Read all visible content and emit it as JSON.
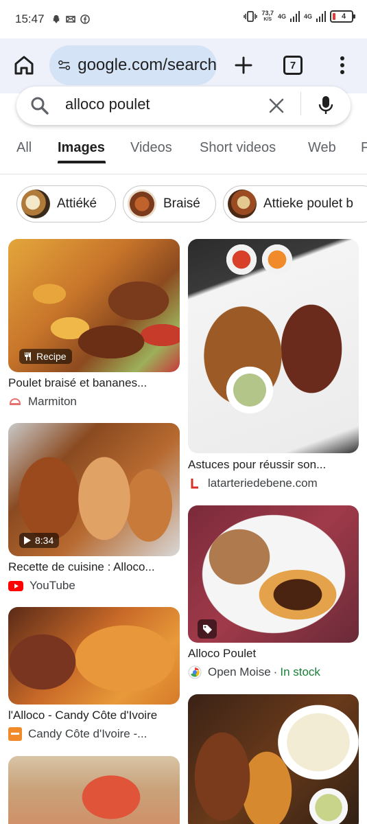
{
  "status_bar": {
    "time": "15:47",
    "net_speed": "73,7",
    "net_unit": "K/S",
    "signal1": "4G",
    "signal2": "4G",
    "battery": "4"
  },
  "browser": {
    "url": "google.com/search",
    "tab_count": "7"
  },
  "search": {
    "query": "alloco poulet"
  },
  "tabs": [
    {
      "label": "All"
    },
    {
      "label": "Images"
    },
    {
      "label": "Videos"
    },
    {
      "label": "Short videos"
    },
    {
      "label": "Web"
    },
    {
      "label": "F"
    }
  ],
  "chips": [
    {
      "label": "Attiéké"
    },
    {
      "label": "Braisé"
    },
    {
      "label": "Attieke poulet b"
    }
  ],
  "results": [
    {
      "title": "Poulet braisé et bananes...",
      "source": "Marmiton",
      "badge": "Recipe"
    },
    {
      "title": "Astuces pour réussir son...",
      "source": "latarteriedebene.com"
    },
    {
      "title": "Recette de cuisine : Alloco...",
      "source": "YouTube",
      "badge": "8:34"
    },
    {
      "title": "Alloco Poulet",
      "source": "Open Moise",
      "separator": "·",
      "stock": "In stock"
    },
    {
      "title": "l'Alloco - Candy Côte d'Ivoire",
      "source": "Candy Côte d'Ivoire -..."
    }
  ]
}
